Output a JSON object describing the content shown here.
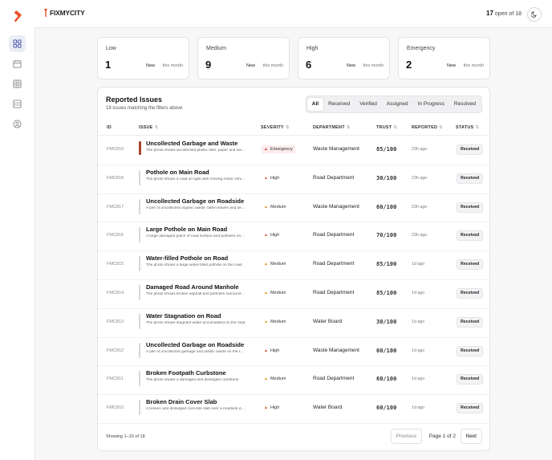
{
  "brand": {
    "name": "FIXMYCITY"
  },
  "header": {
    "open_count": "17",
    "open_suffix": "open of 18"
  },
  "stats": [
    {
      "label": "Low",
      "count": "1",
      "badge": "New",
      "period": "this month"
    },
    {
      "label": "Medium",
      "count": "9",
      "badge": "New",
      "period": "this month"
    },
    {
      "label": "High",
      "count": "6",
      "badge": "New",
      "period": "this month"
    },
    {
      "label": "Emergency",
      "count": "2",
      "badge": "New",
      "period": "this month"
    }
  ],
  "panel": {
    "title": "Reported Issues",
    "subtitle": "18 issues matching the filters above",
    "tabs": [
      "All",
      "Received",
      "Verified",
      "Assigned",
      "In Progress",
      "Resolved"
    ],
    "active_tab": "All",
    "columns": {
      "id": "ID",
      "issue": "ISSUE",
      "severity": "SEVERITY",
      "department": "DEPARTMENT",
      "trust": "TRUST",
      "reported": "REPORTED",
      "status": "STATUS"
    },
    "rows": [
      {
        "id": "FMC819",
        "title": "Uncollected Garbage and Waste",
        "desc": "The photo shows uncollected plastic litter, paper and waste",
        "severity": "Emergency",
        "department": "Waste Management",
        "trust": "85/100",
        "reported": "23h ago",
        "status": "Received"
      },
      {
        "id": "FMC818",
        "title": "Pothole on Main Road",
        "desc": "The photo shows a road at night with moving motor vehicles",
        "severity": "High",
        "department": "Road Department",
        "trust": "30/100",
        "reported": "23h ago",
        "status": "Received"
      },
      {
        "id": "FMC817",
        "title": "Uncollected Garbage on Roadside",
        "desc": "A pile of uncollected organic waste, fallen leaves and debris",
        "severity": "Medium",
        "department": "Waste Management",
        "trust": "60/100",
        "reported": "23h ago",
        "status": "Received"
      },
      {
        "id": "FMC816",
        "title": "Large Pothole on Main Road",
        "desc": "A large damaged patch of road surface and potholes on the main road",
        "severity": "High",
        "department": "Road Department",
        "trust": "70/100",
        "reported": "23h ago",
        "status": "Received"
      },
      {
        "id": "FMC815",
        "title": "Water-filled Pothole on Road",
        "desc": "The photo shows a large water-filled pothole on the road",
        "severity": "Medium",
        "department": "Road Department",
        "trust": "85/100",
        "reported": "1d ago",
        "status": "Received"
      },
      {
        "id": "FMC814",
        "title": "Damaged Road Around Manhole",
        "desc": "The photo shows broken asphalt and potholes surrounding",
        "severity": "Medium",
        "department": "Road Department",
        "trust": "85/100",
        "reported": "1d ago",
        "status": "Received"
      },
      {
        "id": "FMC813",
        "title": "Water Stagnation on Road",
        "desc": "The photo shows stagnant water accumulated on the road",
        "severity": "Medium",
        "department": "Water Board",
        "trust": "30/100",
        "reported": "1d ago",
        "status": "Received"
      },
      {
        "id": "FMC812",
        "title": "Uncollected Garbage on Roadside",
        "desc": "A pile of uncollected garbage and plastic waste on the roadside",
        "severity": "High",
        "department": "Waste Management",
        "trust": "60/100",
        "reported": "1d ago",
        "status": "Received"
      },
      {
        "id": "FMC811",
        "title": "Broken Footpath Curbstone",
        "desc": "The photo shows a damaged and dislodged curbstone",
        "severity": "Medium",
        "department": "Road Department",
        "trust": "60/100",
        "reported": "1d ago",
        "status": "Received"
      },
      {
        "id": "FMC810",
        "title": "Broken Drain Cover Slab",
        "desc": "A broken and dislodged concrete slab over a roadside drain",
        "severity": "High",
        "department": "Water Board",
        "trust": "60/100",
        "reported": "1d ago",
        "status": "Received"
      }
    ],
    "footer": {
      "showing": "Showing 1–10 of 18",
      "prev": "Previous",
      "page_info": "Page 1 of 2",
      "next": "Next"
    }
  },
  "icons": {
    "logo": "hammer-icon",
    "theme": "moon-icon",
    "nav": [
      "dashboard-icon",
      "calendar-icon",
      "grid-icon",
      "list-icon",
      "user-circle-icon"
    ]
  },
  "colors": {
    "accent": "#e8532a",
    "emergency_bg": "#fdecec",
    "high": "#d84a1f",
    "medium": "#e08b10"
  }
}
